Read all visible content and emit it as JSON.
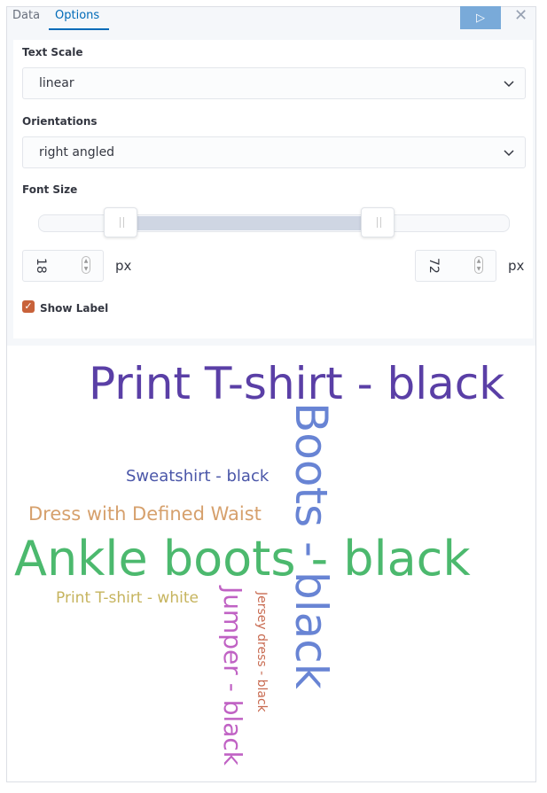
{
  "tabs": [
    {
      "label": "Data"
    },
    {
      "label": "Options"
    }
  ],
  "active_tab": "Options",
  "run_icon": "play-icon",
  "close_icon": "close-icon",
  "options": {
    "text_scale": {
      "label": "Text Scale",
      "value": "linear"
    },
    "orientations": {
      "label": "Orientations",
      "value": "right angled"
    },
    "font_size": {
      "label": "Font Size",
      "min": "18",
      "max": "72",
      "unit": "px"
    },
    "show_label": {
      "label": "Show Label",
      "checked": true
    }
  },
  "colors": {
    "accent": "#006bb8",
    "checkbox": "#c8623a"
  },
  "word_cloud": {
    "words": [
      {
        "text": "Print T-shirt - black",
        "color": "#5a3fa6",
        "orientation": "horizontal"
      },
      {
        "text": "Boots - black",
        "color": "#6884d4",
        "orientation": "vertical"
      },
      {
        "text": "Sweatshirt - black",
        "color": "#4a56a8",
        "orientation": "horizontal"
      },
      {
        "text": "Dress with Defined Waist",
        "color": "#d6a06c",
        "orientation": "horizontal"
      },
      {
        "text": "Ankle boots - black",
        "color": "#4cb96e",
        "orientation": "horizontal"
      },
      {
        "text": "Print T-shirt - white",
        "color": "#c6b45e",
        "orientation": "horizontal"
      },
      {
        "text": "Jumper - black",
        "color": "#c062c4",
        "orientation": "vertical"
      },
      {
        "text": "Jersey dress - black",
        "color": "#c86a50",
        "orientation": "vertical"
      }
    ]
  }
}
